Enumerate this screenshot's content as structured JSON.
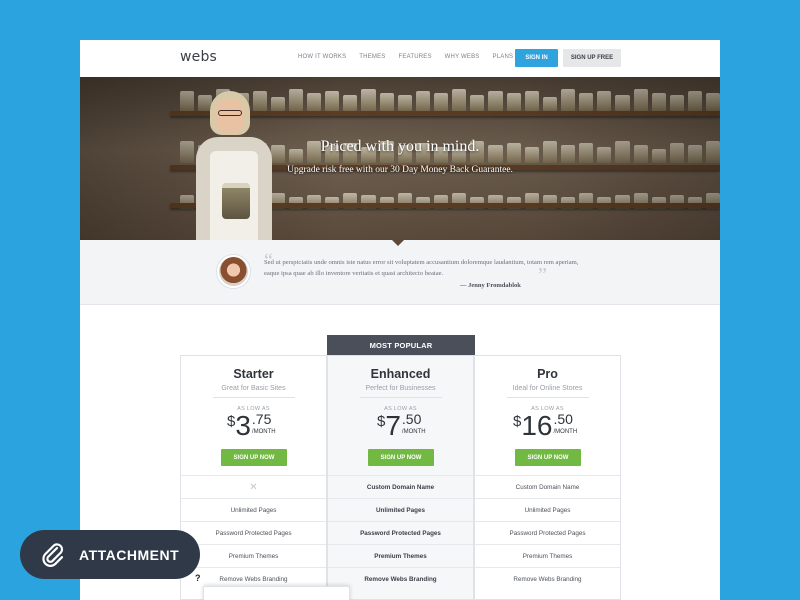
{
  "header": {
    "logo": "webs",
    "nav": [
      "HOW IT WORKS",
      "THEMES",
      "FEATURES",
      "WHY WEBS",
      "PLANS"
    ],
    "sign_in": "SIGN IN",
    "sign_up": "SIGN UP FREE"
  },
  "hero": {
    "title": "Priced with you in mind.",
    "subtitle": "Upgrade risk free with our 30 Day Money Back Guarantee."
  },
  "testimonial": {
    "text": "Sed ut perspiciatis unde omnis iste natus error sit voluptatem accusantium doloremque laudantium, totam rem aperiam, eaque ipsa quae ab illo inventore veritatis et quasi architecto beatae.",
    "author": "— Jenny Fromdablok"
  },
  "pricing": {
    "popular_tag": "MOST POPULAR",
    "as_low_as": "AS LOW AS",
    "signup_label": "SIGN UP NOW",
    "plans": [
      {
        "name": "Starter",
        "desc": "Great for Basic Sites",
        "dollar": "$",
        "whole": "3",
        "cents": ".75",
        "period": "/MONTH",
        "features": [
          "✕",
          "Unlimited Pages",
          "Password Protected Pages",
          "Premium Themes",
          "Remove Webs Branding"
        ]
      },
      {
        "name": "Enhanced",
        "desc": "Perfect for Businesses",
        "dollar": "$",
        "whole": "7",
        "cents": ".50",
        "period": "/MONTH",
        "features": [
          "Custom Domain Name",
          "Unlimited Pages",
          "Password Protected Pages",
          "Premium Themes",
          "Remove Webs Branding"
        ]
      },
      {
        "name": "Pro",
        "desc": "Ideal for Online Stores",
        "dollar": "$",
        "whole": "16",
        "cents": ".50",
        "period": "/MONTH",
        "features": [
          "Custom Domain Name",
          "Unlimited Pages",
          "Password Protected Pages",
          "Premium Themes",
          "Remove Webs Branding"
        ]
      }
    ]
  },
  "tooltip_mark": "?",
  "attachment": {
    "label": "ATTACHMENT",
    "icon": "paperclip-icon"
  },
  "colors": {
    "background": "#2aa3de",
    "sign_in": "#2ea3de",
    "signup_green": "#72b944",
    "popular_tag": "#4a4f59",
    "attachment_pill": "#2f3947"
  }
}
